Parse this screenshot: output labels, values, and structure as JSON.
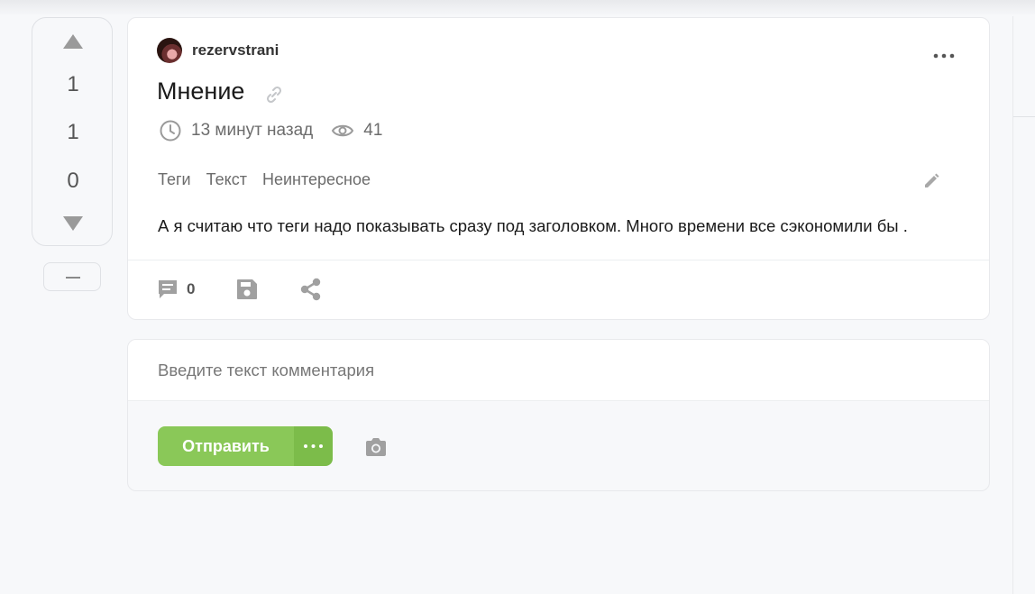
{
  "vote": {
    "rating": "1",
    "pluses": "1",
    "minuses": "0",
    "icons": {
      "up": "triangle-up-icon",
      "down": "triangle-down-icon",
      "hide": "minus-icon"
    }
  },
  "story": {
    "author": "rezervstrani",
    "title": "Мнение",
    "time": "13 минут назад",
    "views": "41",
    "tags": [
      "Теги",
      "Текст",
      "Неинтересное"
    ],
    "body": "А я считаю что теги надо показывать сразу под заголовком. Много времени все сэкономили бы .",
    "comments_count": "0",
    "icons": {
      "more": "more-dots-icon",
      "link": "link-icon",
      "time": "clock-icon",
      "views": "eye-icon",
      "edit": "pencil-icon",
      "comments": "comment-icon",
      "save": "floppy-disk-icon",
      "share": "share-icon"
    }
  },
  "comment_form": {
    "placeholder": "Введите текст комментария",
    "submit_label": "Отправить",
    "icons": {
      "more": "more-dots-icon",
      "photo": "camera-icon"
    }
  },
  "colors": {
    "accent_green": "#8ac858",
    "accent_green_dark": "#7cbc4a",
    "icon_gray": "#9a9a9a",
    "background": "#f7f8fa"
  }
}
